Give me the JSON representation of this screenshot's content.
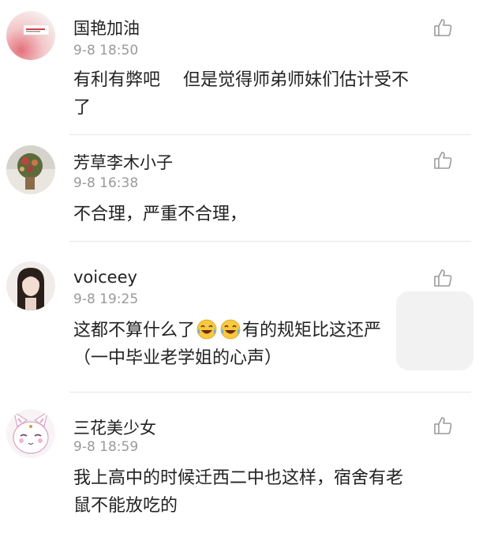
{
  "comments": [
    {
      "username": "国艳加油",
      "time": "9-8 18:50",
      "lines": [
        "有利有弊吧　 但是觉得师弟师妹们估计受不",
        "了"
      ]
    },
    {
      "username": "芳草李木小子",
      "time": "9-8 16:38",
      "lines": [
        "不合理，严重不合理，"
      ]
    },
    {
      "username": "voiceey",
      "time": "9-8 19:25",
      "line1_before": "这都不算什么了",
      "line1_after": "有的规矩比这还严",
      "line2": "（一中毕业老学姐的心声）"
    },
    {
      "username": "三花美少女",
      "time": "9-8 18:59",
      "lines": [
        "我上高中的时候迁西二中也这样，宿舍有老",
        "鼠不能放吃的"
      ]
    }
  ],
  "icons": {
    "like": "thumbs-up-icon",
    "emoji": "tears-of-joy-emoji-icon"
  },
  "colors": {
    "text": "#222222",
    "timestamp": "#9a9a9a",
    "divider": "#e6e6e6",
    "icon": "#9a9a9a"
  }
}
